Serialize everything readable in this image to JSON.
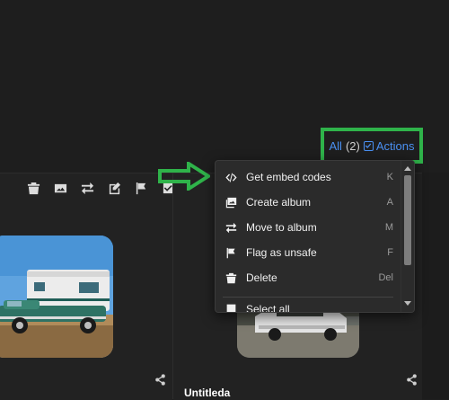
{
  "selection": {
    "all_label": "All",
    "count": "(2)",
    "actions_label": "Actions"
  },
  "menu": {
    "items": [
      {
        "label": "Get embed codes",
        "key": "K",
        "icon": "code-icon"
      },
      {
        "label": "Create album",
        "key": "A",
        "icon": "album-icon"
      },
      {
        "label": "Move to album",
        "key": "M",
        "icon": "move-icon"
      },
      {
        "label": "Flag as unsafe",
        "key": "F",
        "icon": "flag-icon"
      },
      {
        "label": "Delete",
        "key": "Del",
        "icon": "trash-icon"
      }
    ],
    "partial_label": "Select all"
  },
  "toolbar_icons": [
    "trash-icon",
    "image-icon",
    "move-icon",
    "edit-icon",
    "flag-icon",
    "checkbox-icon"
  ],
  "items": [
    {
      "title": ""
    },
    {
      "title": "Untitleda"
    }
  ],
  "colors": {
    "accent": "#4a90f2",
    "annotation": "#2fb34a",
    "background": "#1e1e1e"
  }
}
